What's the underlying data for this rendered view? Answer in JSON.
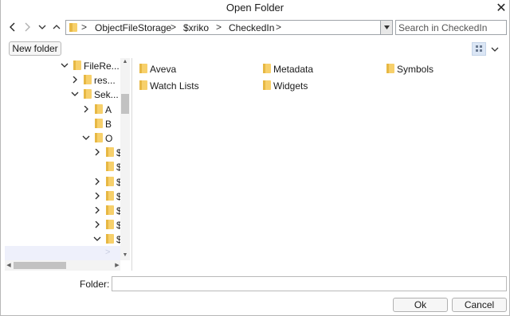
{
  "window": {
    "title": "Open Folder"
  },
  "toolbar": {
    "breadcrumbs": [
      "ObjectFileStorage",
      "$xriko",
      "CheckedIn"
    ],
    "search_placeholder": "Search in CheckedIn",
    "new_folder_label": "New folder"
  },
  "tree": {
    "rows": [
      {
        "label": "FileRe...",
        "chevron": "down",
        "level": 0
      },
      {
        "label": "res...",
        "chevron": "right",
        "level": 1
      },
      {
        "label": "Sek...",
        "chevron": "down",
        "level": 1
      },
      {
        "label": "A",
        "chevron": "right",
        "level": 2
      },
      {
        "label": "B",
        "chevron": "none",
        "level": 2
      },
      {
        "label": "O",
        "chevron": "down",
        "level": 2
      },
      {
        "label": "$",
        "chevron": "right",
        "level": 3
      },
      {
        "label": "$",
        "chevron": "none",
        "level": 3
      },
      {
        "label": "$",
        "chevron": "right",
        "level": 3
      },
      {
        "label": "$",
        "chevron": "right",
        "level": 3
      },
      {
        "label": "$",
        "chevron": "right",
        "level": 3
      },
      {
        "label": "$",
        "chevron": "right",
        "level": 3
      },
      {
        "label": "$",
        "chevron": "down",
        "level": 3
      }
    ]
  },
  "items": [
    "Aveva",
    "Metadata",
    "Symbols",
    "Watch Lists",
    "Widgets"
  ],
  "footer": {
    "folder_label": "Folder:",
    "folder_value": "",
    "ok_label": "Ok",
    "cancel_label": "Cancel"
  },
  "colors": {
    "folder": "#f7d06b",
    "folder_dark": "#e7b844",
    "selection": "#eef0fb"
  }
}
